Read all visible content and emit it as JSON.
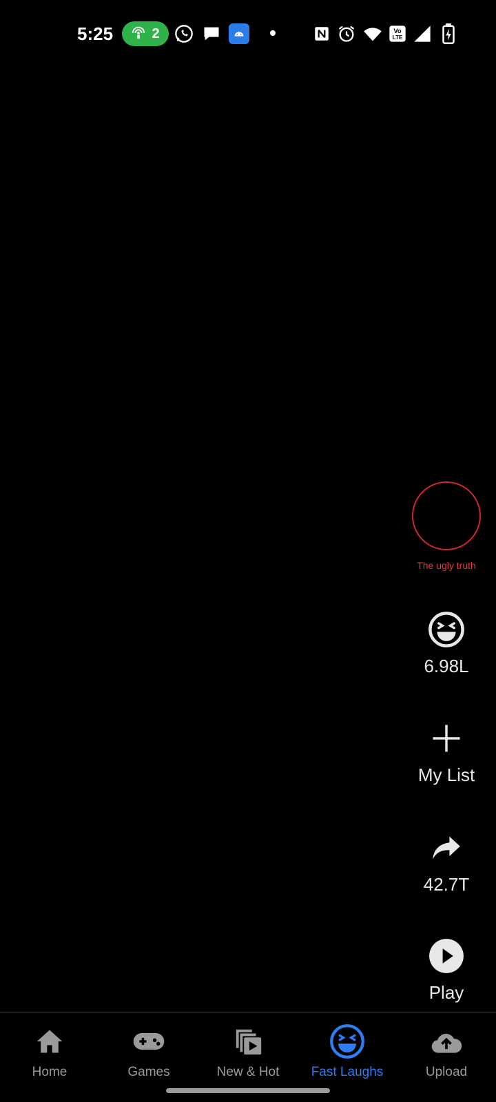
{
  "status_bar": {
    "time": "5:25",
    "hotspot_count": "2",
    "icons": [
      "hotspot-icon",
      "whatsapp-icon",
      "messages-icon",
      "android-icon",
      "dot",
      "nfc-icon",
      "alarm-icon",
      "wifi-icon",
      "volte-icon",
      "signal-icon",
      "battery-charging-icon"
    ],
    "hotspot_color": "#2fb24a"
  },
  "rail": {
    "title_label": "The ugly truth",
    "lol_count": "6.98L",
    "my_list_label": "My List",
    "share_count": "42.7T",
    "play_label": "Play",
    "accent_red": "#d0262d"
  },
  "nav": {
    "items": [
      {
        "label": "Home",
        "icon": "home-icon"
      },
      {
        "label": "Games",
        "icon": "gamepad-icon"
      },
      {
        "label": "New & Hot",
        "icon": "new-hot-icon"
      },
      {
        "label": "Fast Laughs",
        "icon": "laugh-icon"
      },
      {
        "label": "Upload",
        "icon": "upload-cloud-icon"
      }
    ],
    "active_index": 3,
    "active_color": "#2f7df0",
    "inactive_color": "#9a9a9a"
  }
}
